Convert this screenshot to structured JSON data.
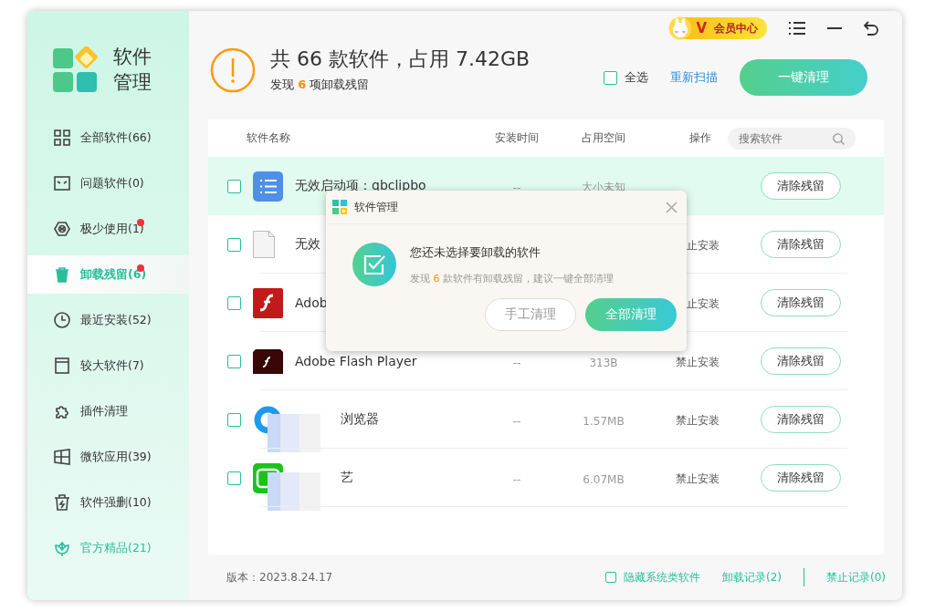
{
  "title_bar": {
    "member_badge": "会员中心",
    "member_letter": "V"
  },
  "app_name": [
    "软件",
    "管理"
  ],
  "sidebar": {
    "items": [
      {
        "label": "全部软件(66)",
        "selected": false,
        "dot": false,
        "kind": "normal"
      },
      {
        "label": "问题软件(0)",
        "selected": false,
        "dot": false,
        "kind": "normal"
      },
      {
        "label": "极少使用(1)",
        "selected": false,
        "dot": true,
        "kind": "normal"
      },
      {
        "label": "卸载残留(6)",
        "selected": true,
        "dot": true,
        "kind": "normal"
      },
      {
        "label": "最近安装(52)",
        "selected": false,
        "dot": false,
        "kind": "normal"
      },
      {
        "label": "较大软件(7)",
        "selected": false,
        "dot": false,
        "kind": "normal"
      },
      {
        "label": "插件清理",
        "selected": false,
        "dot": false,
        "kind": "normal"
      },
      {
        "label": "微软应用(39)",
        "selected": false,
        "dot": false,
        "kind": "normal"
      },
      {
        "label": "软件强删(10)",
        "selected": false,
        "dot": false,
        "kind": "normal"
      },
      {
        "label": "官方精品(21)",
        "selected": false,
        "dot": false,
        "kind": "featured"
      }
    ]
  },
  "summary": {
    "title": "共 66 款软件，占用 7.42GB",
    "found_prefix": "发现",
    "found_count": "6",
    "found_suffix": "项卸载残留"
  },
  "select_all": {
    "label": "全选",
    "checked": false
  },
  "rescan_link": "重新扫描",
  "clean_button": "一键清理",
  "table": {
    "columns": [
      "软件名称",
      "安装时间",
      "占用空间",
      "操作"
    ],
    "search": {
      "placeholder": "搜索软件"
    },
    "rows": [
      {
        "name": "无效启动项：qbclipbo",
        "install_time": "--",
        "size": "大小未知",
        "status": "",
        "action": "清除残留",
        "checked": false,
        "highlighted": true,
        "redacted": false
      },
      {
        "name": "无效",
        "install_time": "",
        "size": "",
        "status": "止安装",
        "action": "清除残留",
        "checked": false,
        "highlighted": false,
        "redacted": false
      },
      {
        "name": "Adob",
        "install_time": "",
        "size": "",
        "status": "止安装",
        "action": "清除残留",
        "checked": false,
        "highlighted": false,
        "redacted": false
      },
      {
        "name": "Adobe Flash Player",
        "install_time": "--",
        "size": "313B",
        "status": "禁止安装",
        "action": "清除残留",
        "checked": false,
        "highlighted": false,
        "redacted": false
      },
      {
        "name": "浏览器",
        "install_time": "--",
        "size": "1.57MB",
        "status": "禁止安装",
        "action": "清除残留",
        "checked": false,
        "highlighted": false,
        "redacted": true
      },
      {
        "name": "艺",
        "install_time": "--",
        "size": "6.07MB",
        "status": "禁止安装",
        "action": "清除残留",
        "checked": false,
        "highlighted": false,
        "redacted": true
      }
    ]
  },
  "dialog": {
    "title": "软件管理",
    "message": "您还未选择要卸载的软件",
    "detail_prefix": "发现",
    "detail_count": "6",
    "detail_suffix": "款软件有卸载残留，建议一键全部清理",
    "buttons": [
      {
        "label": "手工清理",
        "kind": "secondary"
      },
      {
        "label": "全部清理",
        "kind": "primary"
      }
    ]
  },
  "footer": {
    "version": "版本：2023.8.24.17",
    "hide_system": {
      "label": "隐藏系统类软件",
      "checked": false
    },
    "links": [
      "卸载记录(2)",
      "禁止记录(0)"
    ]
  }
}
